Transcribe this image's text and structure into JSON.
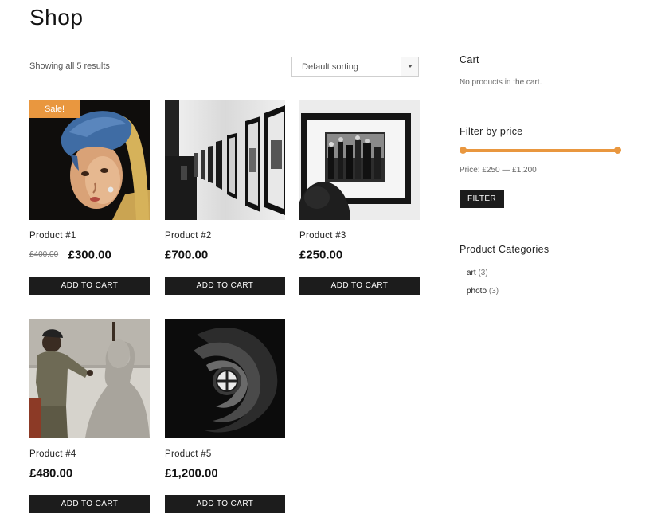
{
  "page": {
    "title": "Shop"
  },
  "toolbar": {
    "result_count": "Showing all 5 results",
    "sort_selected": "Default sorting"
  },
  "products": [
    {
      "name": "Product #1",
      "old_price": "£400.00",
      "price": "£300.00",
      "badge": "Sale!",
      "button": "ADD TO CART",
      "image": "girl-with-pearl-earring-painting"
    },
    {
      "name": "Product #2",
      "price": "£700.00",
      "button": "ADD TO CART",
      "image": "gallery-frames-bw-photo"
    },
    {
      "name": "Product #3",
      "price": "£250.00",
      "button": "ADD TO CART",
      "image": "framed-photo-on-wall"
    },
    {
      "name": "Product #4",
      "price": "£480.00",
      "button": "ADD TO CART",
      "image": "sculptor-with-bust"
    },
    {
      "name": "Product #5",
      "price": "£1,200.00",
      "button": "ADD TO CART",
      "image": "spiral-staircase-bw"
    }
  ],
  "sidebar": {
    "cart": {
      "title": "Cart",
      "empty_text": "No products in the cart."
    },
    "price_filter": {
      "title": "Filter by price",
      "price_label": "Price: £250 — £1,200",
      "button": "FILTER",
      "accent_color": "#e9973f"
    },
    "categories": {
      "title": "Product Categories",
      "items": [
        {
          "name": "art",
          "count": "(3)"
        },
        {
          "name": "photo",
          "count": "(3)"
        }
      ]
    }
  },
  "colors": {
    "accent": "#e9973f",
    "button_bg": "#1c1c1c"
  }
}
